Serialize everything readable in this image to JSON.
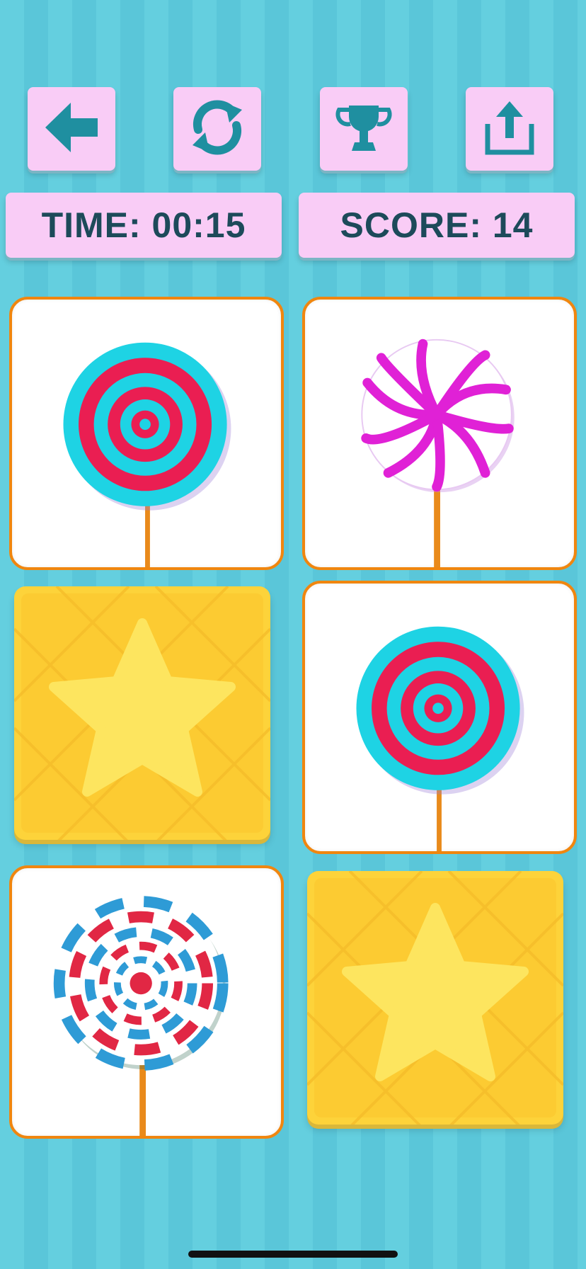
{
  "toolbar": {
    "back_icon": "arrow-left-icon",
    "restart_icon": "refresh-icon",
    "trophy_icon": "trophy-icon",
    "share_icon": "share-icon",
    "accent_color": "#1f8fa0",
    "button_color": "#f9ccf6"
  },
  "stats": {
    "time_text": "TIME: 00:15",
    "score_text": "SCORE: 14"
  },
  "cards": [
    {
      "state": "revealed",
      "item": "lollipop-cyan-red-swirl"
    },
    {
      "state": "revealed",
      "item": "lollipop-magenta-white-spiral"
    },
    {
      "state": "hidden",
      "item": "star-card-back"
    },
    {
      "state": "revealed",
      "item": "lollipop-cyan-red-swirl"
    },
    {
      "state": "revealed",
      "item": "lollipop-blue-red-white-spiral"
    },
    {
      "state": "hidden",
      "item": "star-card-back"
    }
  ],
  "colors": {
    "background": "#5ecadb",
    "card_border": "#f0860f",
    "card_back": "#fdd33a",
    "star": "#fde55f"
  }
}
